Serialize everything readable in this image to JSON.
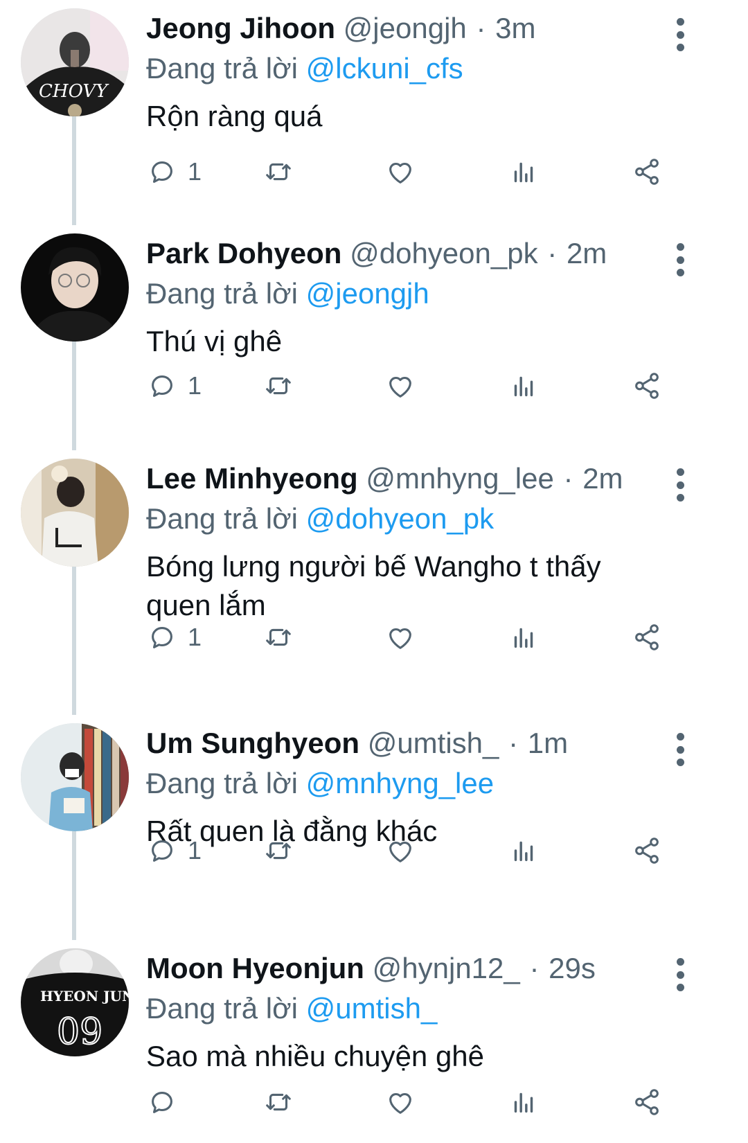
{
  "colors": {
    "primary_text": "#0f1419",
    "secondary_text": "#536471",
    "mention": "#1d9bf0",
    "thread_line": "#cfd9de"
  },
  "reply_prefix": "Đang trả lời",
  "tweets": [
    {
      "name": "Jeong Jihoon",
      "handle": "@jeongjh",
      "time": "3m",
      "reply_to": "@lckuni_cfs",
      "text": "Rộn ràng quá",
      "reply_count": "1",
      "avatar_text": "CHOVY"
    },
    {
      "name": "Park Dohyeon",
      "handle": "@dohyeon_pk",
      "time": "2m",
      "reply_to": "@jeongjh",
      "text": "Thú vị ghê",
      "reply_count": "1"
    },
    {
      "name": "Lee Minhyeong",
      "handle": "@mnhyng_lee",
      "time": "2m",
      "reply_to": "@dohyeon_pk",
      "text": "Bóng lưng người bế Wangho t thấy quen lắm",
      "reply_count": "1"
    },
    {
      "name": "Um Sunghyeon",
      "handle": "@umtish_",
      "time": "1m",
      "reply_to": "@mnhyng_lee",
      "text": "Rất quen là đằng khác",
      "reply_count": "1"
    },
    {
      "name": "Moon Hyeonjun",
      "handle": "@hynjn12_",
      "time": "29s",
      "reply_to": "@umtish_",
      "text": "Sao mà nhiều chuyện ghê",
      "reply_count": "",
      "avatar_text": "HYEON JUN",
      "avatar_number": "09"
    }
  ]
}
